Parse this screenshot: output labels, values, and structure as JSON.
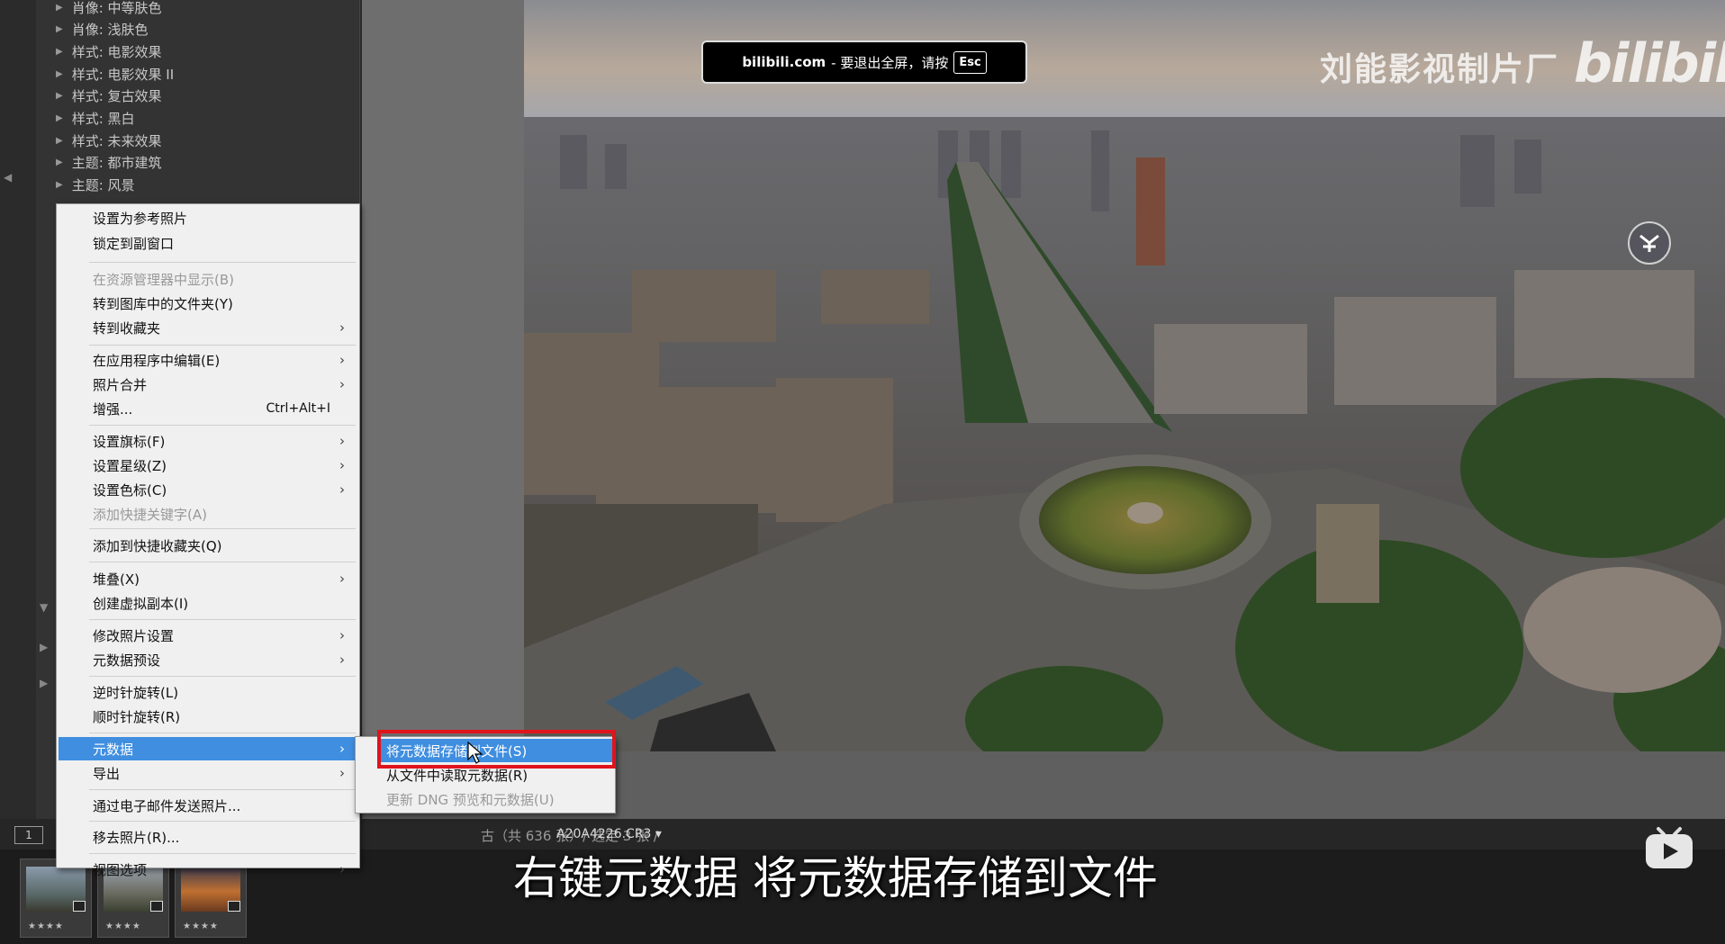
{
  "presets": [
    "肖像: 中等肤色",
    "肖像: 浅肤色",
    "样式: 电影效果",
    "样式: 电影效果 II",
    "样式: 复古效果",
    "样式: 黑白",
    "样式: 未来效果",
    "主题: 都市建筑",
    "主题: 风景"
  ],
  "context_menu": {
    "items": [
      {
        "label": "设置为参考照片",
        "shortcut": "",
        "submenu": false,
        "disabled": false
      },
      {
        "label": "锁定到副窗口",
        "shortcut": "",
        "submenu": false,
        "disabled": false
      },
      {
        "label": "在资源管理器中显示(B)",
        "shortcut": "",
        "submenu": false,
        "disabled": true
      },
      {
        "label": "转到图库中的文件夹(Y)",
        "shortcut": "",
        "submenu": false,
        "disabled": false
      },
      {
        "label": "转到收藏夹",
        "shortcut": "",
        "submenu": true,
        "disabled": false
      },
      {
        "label": "在应用程序中编辑(E)",
        "shortcut": "",
        "submenu": true,
        "disabled": false
      },
      {
        "label": "照片合并",
        "shortcut": "",
        "submenu": true,
        "disabled": false
      },
      {
        "label": "增强...",
        "shortcut": "Ctrl+Alt+I",
        "submenu": false,
        "disabled": false
      },
      {
        "label": "设置旗标(F)",
        "shortcut": "",
        "submenu": true,
        "disabled": false
      },
      {
        "label": "设置星级(Z)",
        "shortcut": "",
        "submenu": true,
        "disabled": false
      },
      {
        "label": "设置色标(C)",
        "shortcut": "",
        "submenu": true,
        "disabled": false
      },
      {
        "label": "添加快捷关键字(A)",
        "shortcut": "",
        "submenu": false,
        "disabled": true
      },
      {
        "label": "添加到快捷收藏夹(Q)",
        "shortcut": "",
        "submenu": false,
        "disabled": false
      },
      {
        "label": "堆叠(X)",
        "shortcut": "",
        "submenu": true,
        "disabled": false
      },
      {
        "label": "创建虚拟副本(I)",
        "shortcut": "",
        "submenu": false,
        "disabled": false
      },
      {
        "label": "修改照片设置",
        "shortcut": "",
        "submenu": true,
        "disabled": false
      },
      {
        "label": "元数据预设",
        "shortcut": "",
        "submenu": true,
        "disabled": false
      },
      {
        "label": "逆时针旋转(L)",
        "shortcut": "",
        "submenu": false,
        "disabled": false
      },
      {
        "label": "顺时针旋转(R)",
        "shortcut": "",
        "submenu": false,
        "disabled": false
      },
      {
        "label": "元数据",
        "shortcut": "",
        "submenu": true,
        "disabled": false,
        "highlighted": true
      },
      {
        "label": "导出",
        "shortcut": "",
        "submenu": true,
        "disabled": false
      },
      {
        "label": "通过电子邮件发送照片...",
        "shortcut": "",
        "submenu": false,
        "disabled": false
      },
      {
        "label": "移去照片(R)...",
        "shortcut": "",
        "submenu": false,
        "disabled": false
      },
      {
        "label": "视图选项",
        "shortcut": "",
        "submenu": true,
        "disabled": false
      }
    ]
  },
  "submenu": {
    "items": [
      {
        "label": "将元数据存储到文件(S)",
        "highlighted": true,
        "disabled": false
      },
      {
        "label": "从文件中读取元数据(R)",
        "highlighted": false,
        "disabled": false
      },
      {
        "label": "更新 DNG 预览和元数据(U)",
        "highlighted": false,
        "disabled": true
      }
    ]
  },
  "filmstrip": {
    "monitor_label": "1",
    "count_text": "古（共 636 张）/ 选定 3 张 /",
    "file_name": "A20A4226.CR3 ▾",
    "thumb_stars": "★★★★"
  },
  "overlays": {
    "fullscreen_site": "bilibili.com",
    "fullscreen_text": "- 要退出全屏，请按",
    "fullscreen_key": "Esc",
    "watermark": "刘能影视制片厂",
    "logo": "bilibili",
    "subtitle": "右键元数据  将元数据存储到文件"
  },
  "colors": {
    "menu_highlight": "#3f8ee0",
    "annotation_box": "#e0141c"
  }
}
